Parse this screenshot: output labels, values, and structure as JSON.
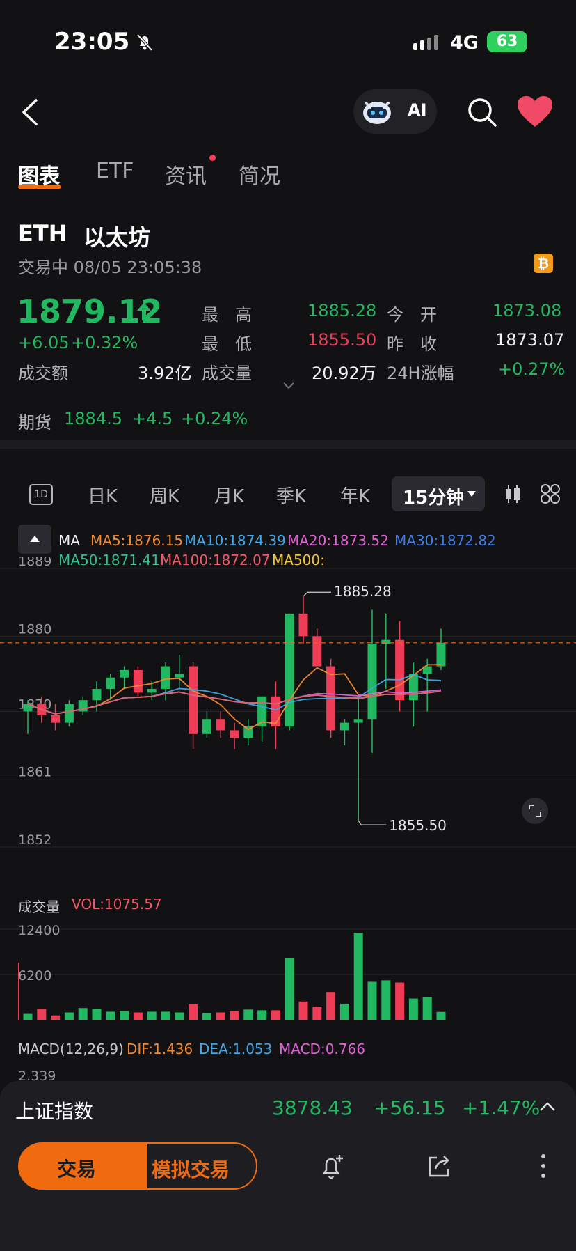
{
  "status": {
    "time": "23:05",
    "network": "4G",
    "battery": "63"
  },
  "header": {
    "ai_label": "AI"
  },
  "tabs": [
    {
      "label": "图表",
      "active": true
    },
    {
      "label": "ETF"
    },
    {
      "label": "资讯",
      "dot": true
    },
    {
      "label": "简况"
    }
  ],
  "asset": {
    "symbol": "ETH",
    "name": "以太坊",
    "status": "交易中 08/05 23:05:38",
    "badge": "₿"
  },
  "quote": {
    "price": "1879.12",
    "change": "+6.05",
    "change_pct": "+0.32%",
    "high_label": "最　高",
    "high": "1885.28",
    "low_label": "最　低",
    "low": "1855.50",
    "open_label": "今　开",
    "open": "1873.08",
    "prev_label": "昨　收",
    "prev": "1873.07",
    "amount_label": "成交额",
    "amount": "3.92亿",
    "volume_label": "成交量",
    "volume": "20.92万",
    "h24_label": "24H涨幅",
    "h24": "+0.27%"
  },
  "futures": {
    "label": "期货",
    "price": "1884.5",
    "change": "+4.5",
    "pct": "+0.24%"
  },
  "periods": [
    "日K",
    "周K",
    "月K",
    "季K",
    "年K"
  ],
  "period_icon": "1D",
  "period_selected": "15分钟",
  "ma": {
    "label": "MA",
    "ma5": "MA5:1876.15",
    "ma10": "MA10:1874.39",
    "ma20": "MA20:1873.52",
    "ma30": "MA30:1872.82",
    "ma50": "MA50:1871.41",
    "ma100": "MA100:1872.07",
    "ma500": "MA500:"
  },
  "volume_panel": {
    "label": "成交量",
    "vol": "VOL:1075.57",
    "tick_high": "12400",
    "tick_mid": "6200"
  },
  "macd": {
    "label": "MACD(12,26,9)",
    "dif": "DIF:1.436",
    "dea": "DEA:1.053",
    "macd": "MACD:0.766",
    "tick": "2.339"
  },
  "index_bar": {
    "name": "上证指数",
    "value": "3878.43",
    "change": "+56.15",
    "pct": "+1.47%"
  },
  "bottom": {
    "trade": "交易",
    "sim_trade": "模拟交易"
  },
  "colors": {
    "up": "#22b761",
    "down": "#f03d57",
    "accent": "#f06a0f",
    "bg": "#121214"
  },
  "chart_data": {
    "type": "candlestick",
    "title": "",
    "ylim": [
      1852,
      1889
    ],
    "y_ticks": [
      1889,
      1880,
      1870,
      1861,
      1852
    ],
    "current_price": 1879.12,
    "annotations": {
      "high": "1885.28",
      "low": "1855.50"
    },
    "candles": [
      {
        "o": 1870.0,
        "h": 1871.5,
        "l": 1867.0,
        "c": 1871.0
      },
      {
        "o": 1871.0,
        "h": 1872.0,
        "l": 1868.5,
        "c": 1869.5
      },
      {
        "o": 1869.5,
        "h": 1871.0,
        "l": 1867.5,
        "c": 1868.5
      },
      {
        "o": 1868.5,
        "h": 1871.5,
        "l": 1868.0,
        "c": 1871.0
      },
      {
        "o": 1870.0,
        "h": 1872.0,
        "l": 1869.5,
        "c": 1871.5
      },
      {
        "o": 1871.5,
        "h": 1874.0,
        "l": 1870.0,
        "c": 1873.0
      },
      {
        "o": 1873.0,
        "h": 1875.0,
        "l": 1871.5,
        "c": 1874.5
      },
      {
        "o": 1874.5,
        "h": 1876.0,
        "l": 1873.0,
        "c": 1875.5
      },
      {
        "o": 1875.5,
        "h": 1876.0,
        "l": 1872.0,
        "c": 1872.5
      },
      {
        "o": 1872.5,
        "h": 1874.0,
        "l": 1871.5,
        "c": 1873.0
      },
      {
        "o": 1873.0,
        "h": 1876.5,
        "l": 1871.5,
        "c": 1876.0
      },
      {
        "o": 1874.5,
        "h": 1877.5,
        "l": 1873.0,
        "c": 1875.0
      },
      {
        "o": 1876.0,
        "h": 1876.5,
        "l": 1865.0,
        "c": 1867.0
      },
      {
        "o": 1867.0,
        "h": 1870.0,
        "l": 1866.5,
        "c": 1869.0
      },
      {
        "o": 1869.0,
        "h": 1870.0,
        "l": 1866.5,
        "c": 1867.5
      },
      {
        "o": 1867.5,
        "h": 1868.5,
        "l": 1865.0,
        "c": 1866.5
      },
      {
        "o": 1866.5,
        "h": 1869.0,
        "l": 1865.5,
        "c": 1868.0
      },
      {
        "o": 1868.0,
        "h": 1872.0,
        "l": 1866.0,
        "c": 1872.0
      },
      {
        "o": 1872.0,
        "h": 1874.0,
        "l": 1865.0,
        "c": 1868.0
      },
      {
        "o": 1868.0,
        "h": 1883.0,
        "l": 1867.5,
        "c": 1883.0
      },
      {
        "o": 1883.0,
        "h": 1885.28,
        "l": 1879.0,
        "c": 1880.0
      },
      {
        "o": 1880.0,
        "h": 1881.0,
        "l": 1876.0,
        "c": 1876.0
      },
      {
        "o": 1876.0,
        "h": 1877.0,
        "l": 1866.5,
        "c": 1867.5
      },
      {
        "o": 1867.5,
        "h": 1869.0,
        "l": 1865.5,
        "c": 1868.5
      },
      {
        "o": 1868.5,
        "h": 1872.0,
        "l": 1855.5,
        "c": 1869.0
      },
      {
        "o": 1869.0,
        "h": 1883.5,
        "l": 1864.5,
        "c": 1879.0
      },
      {
        "o": 1879.0,
        "h": 1883.0,
        "l": 1873.0,
        "c": 1879.5
      },
      {
        "o": 1879.5,
        "h": 1882.0,
        "l": 1870.0,
        "c": 1871.5
      },
      {
        "o": 1871.5,
        "h": 1876.5,
        "l": 1868.0,
        "c": 1875.0
      },
      {
        "o": 1875.0,
        "h": 1877.0,
        "l": 1870.0,
        "c": 1876.0
      },
      {
        "o": 1876.0,
        "h": 1881.0,
        "l": 1875.5,
        "c": 1879.12
      }
    ],
    "volumes": [
      800,
      1500,
      600,
      1000,
      1600,
      1500,
      1100,
      1200,
      1000,
      1100,
      1100,
      1000,
      2100,
      900,
      1000,
      1200,
      1400,
      1300,
      1300,
      8400,
      2500,
      1800,
      3800,
      2200,
      11900,
      5200,
      5400,
      5100,
      2900,
      3100,
      1075
    ]
  }
}
